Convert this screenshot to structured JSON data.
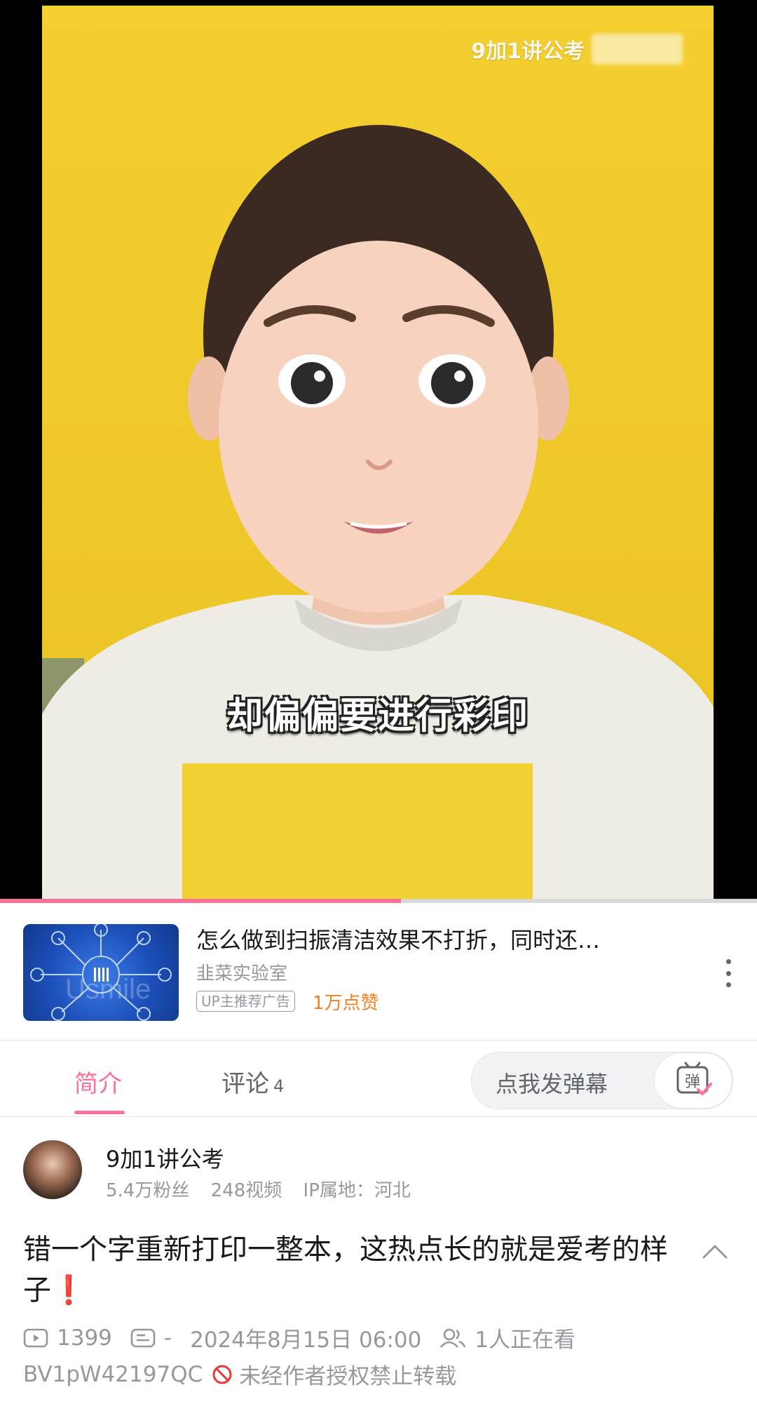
{
  "video": {
    "watermark": "9加1讲公考",
    "subtitle": "却偏偏要进行彩印",
    "progress": 0.53
  },
  "ad": {
    "title": "怎么做到扫振清洁效果不打折，同时还…",
    "source": "韭菜实验室",
    "tag": "UP主推荐广告",
    "likes": "1万点赞",
    "thumb_text": "Usmile"
  },
  "tabs": {
    "intro": "简介",
    "comments": "评论",
    "comments_count": "4",
    "danmaku_placeholder": "点我发弹幕",
    "danmaku_icon_char": "弹"
  },
  "uploader": {
    "name": "9加1讲公考",
    "fans": "5.4万粉丝",
    "videos": "248视频",
    "ip": "IP属地：河北"
  },
  "video_info": {
    "title": "错一个字重新打印一整本，这热点长的就是爱考的样子",
    "title_emoji": "❗",
    "plays": "1399",
    "danmaku_count": "-",
    "date": "2024年8月15日 06:00",
    "watching": "1人正在看",
    "bvid": "BV1pW42197QC",
    "copyright": "未经作者授权禁止转载"
  },
  "colors": {
    "accent": "#fb7299",
    "ad_likes": "#f57f23",
    "muted": "#9499a0"
  }
}
